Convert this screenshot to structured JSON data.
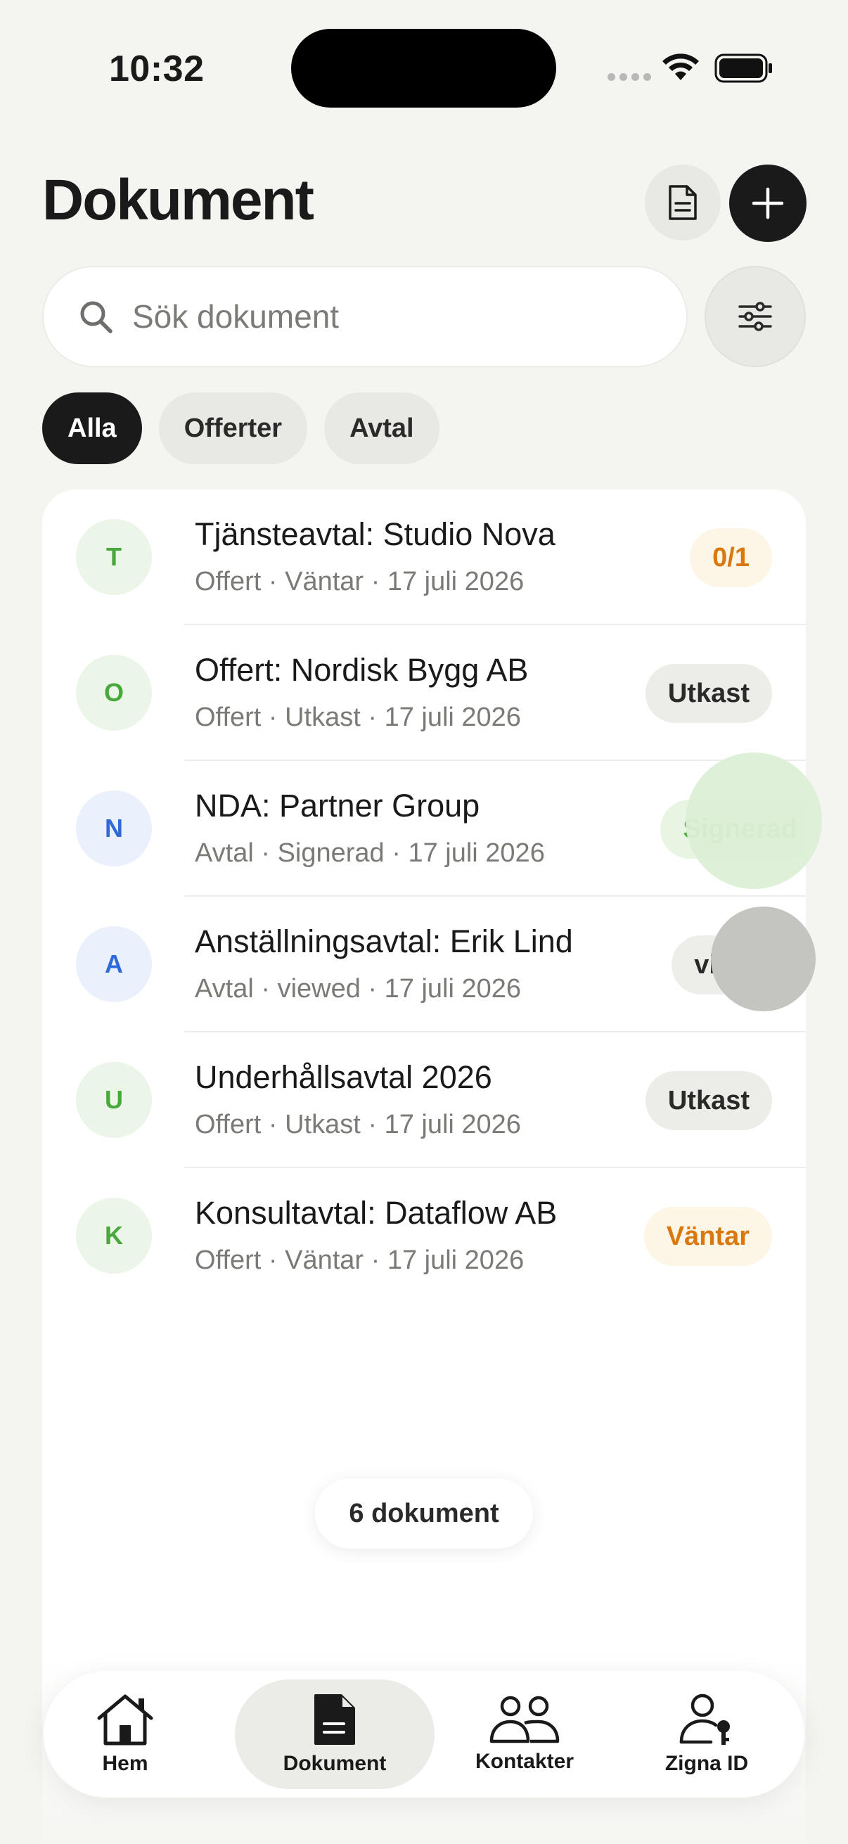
{
  "status_bar": {
    "time": "10:32",
    "icons": [
      "cellular-dots-icon",
      "wifi-icon",
      "battery-icon"
    ]
  },
  "header": {
    "title": "Dokument",
    "actions": [
      "document-icon",
      "plus-icon"
    ]
  },
  "search": {
    "placeholder": "Sök dokument",
    "value": ""
  },
  "filters": {
    "icon": "sliders-icon",
    "chips": [
      {
        "label": "Alla",
        "active": true
      },
      {
        "label": "Offerter",
        "active": false
      },
      {
        "label": "Avtal",
        "active": false
      }
    ]
  },
  "documents": [
    {
      "initial": "T",
      "color": "green",
      "title": "Tjänsteavtal: Studio Nova",
      "subtitle": "Offert · Väntar · 17 juli 2026",
      "badge": "0/1",
      "badge_style": "pending"
    },
    {
      "initial": "O",
      "color": "green",
      "title": "Offert: Nordisk Bygg AB",
      "subtitle": "Offert · Utkast · 17 juli 2026",
      "badge": "Utkast",
      "badge_style": "draft"
    },
    {
      "initial": "N",
      "color": "blue",
      "title": "NDA: Partner Group",
      "subtitle": "Avtal · Signerad · 17 juli 2026",
      "badge": "Signerad",
      "badge_style": "signed"
    },
    {
      "initial": "A",
      "color": "blue",
      "title": "Anställningsavtal: Erik Lind",
      "subtitle": "Avtal · viewed · 17 juli 2026",
      "badge": "viewed",
      "badge_style": "viewed"
    },
    {
      "initial": "U",
      "color": "green",
      "title": "Underhållsavtal 2026",
      "subtitle": "Offert · Utkast · 17 juli 2026",
      "badge": "Utkast",
      "badge_style": "draft"
    },
    {
      "initial": "K",
      "color": "green",
      "title": "Konsultavtal: Dataflow AB",
      "subtitle": "Offert · Väntar · 17 juli 2026",
      "badge": "Väntar",
      "badge_style": "pending"
    }
  ],
  "count_label": "6 dokument",
  "tab_bar": {
    "tabs": [
      {
        "label": "Hem",
        "icon": "home-icon",
        "active": false
      },
      {
        "label": "Dokument",
        "icon": "document-icon",
        "active": true
      },
      {
        "label": "Kontakter",
        "icon": "contacts-icon",
        "active": false
      },
      {
        "label": "Zigna ID",
        "icon": "person-key-icon",
        "active": false
      }
    ]
  },
  "colors": {
    "background": "#f4f4f1",
    "accent_dark": "#1a1a1a",
    "pending": "#d9780e",
    "signed": "#4ab33c",
    "avatar_green": "#49a83c",
    "avatar_blue": "#2e6ad8"
  }
}
